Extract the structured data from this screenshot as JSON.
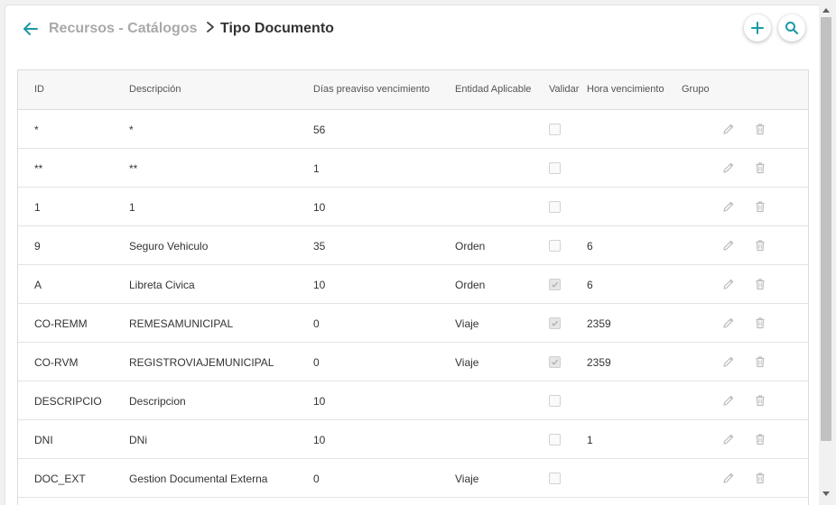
{
  "header": {
    "parent": "Recursos - Catálogos",
    "current": "Tipo Documento",
    "back_icon": "arrow-left-icon",
    "add_icon": "plus-icon",
    "search_icon": "search-icon",
    "accent_color": "#1a9aa6"
  },
  "table": {
    "columns": {
      "id": "ID",
      "descripcion": "Descripción",
      "dias": "Días preaviso vencimiento",
      "entidad": "Entidad Aplicable",
      "validar": "Validar",
      "hora": "Hora vencimiento",
      "grupo": "Grupo"
    },
    "rows": [
      {
        "id": "*",
        "descripcion": "*",
        "dias": "56",
        "entidad": "",
        "validar": false,
        "hora": "",
        "grupo": ""
      },
      {
        "id": "**",
        "descripcion": "**",
        "dias": "1",
        "entidad": "",
        "validar": false,
        "hora": "",
        "grupo": ""
      },
      {
        "id": "1",
        "descripcion": "1",
        "dias": "10",
        "entidad": "",
        "validar": false,
        "hora": "",
        "grupo": ""
      },
      {
        "id": "9",
        "descripcion": "Seguro Vehiculo",
        "dias": "35",
        "entidad": "Orden",
        "validar": false,
        "hora": "6",
        "grupo": ""
      },
      {
        "id": "A",
        "descripcion": "Libreta Civica",
        "dias": "10",
        "entidad": "Orden",
        "validar": true,
        "hora": "6",
        "grupo": ""
      },
      {
        "id": "CO-REMM",
        "descripcion": "REMESAMUNICIPAL",
        "dias": "0",
        "entidad": "Viaje",
        "validar": true,
        "hora": "2359",
        "grupo": ""
      },
      {
        "id": "CO-RVM",
        "descripcion": "REGISTROVIAJEMUNICIPAL",
        "dias": "0",
        "entidad": "Viaje",
        "validar": true,
        "hora": "2359",
        "grupo": ""
      },
      {
        "id": "DESCRIPCIO",
        "descripcion": "Descripcion",
        "dias": "10",
        "entidad": "",
        "validar": false,
        "hora": "",
        "grupo": ""
      },
      {
        "id": "DNI",
        "descripcion": "DNi",
        "dias": "10",
        "entidad": "",
        "validar": false,
        "hora": "1",
        "grupo": ""
      },
      {
        "id": "DOC_EXT",
        "descripcion": "Gestion Documental Externa",
        "dias": "0",
        "entidad": "Viaje",
        "validar": false,
        "hora": "",
        "grupo": ""
      }
    ],
    "row_actions": {
      "edit_icon": "pencil-icon",
      "delete_icon": "trash-icon"
    }
  }
}
